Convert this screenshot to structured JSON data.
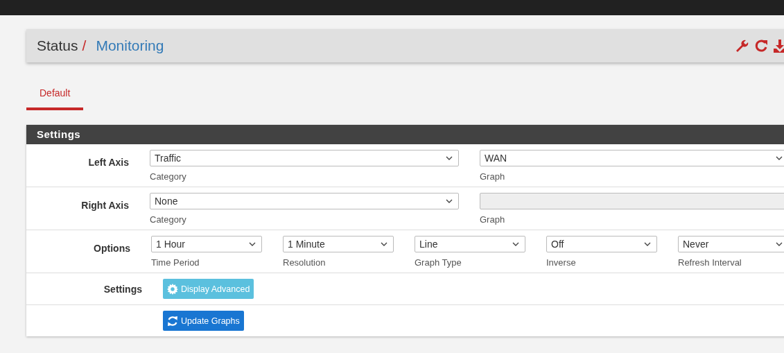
{
  "breadcrumb": {
    "section": "Status",
    "separator": "/",
    "page": "Monitoring"
  },
  "tabs": [
    {
      "label": "Default",
      "selected": true
    }
  ],
  "settings": {
    "title": "Settings",
    "rows": [
      {
        "label": "Left Axis",
        "kind": "axis",
        "fields": [
          {
            "value": "Traffic",
            "caption": "Category",
            "disabled": false
          },
          {
            "value": "WAN",
            "caption": "Graph",
            "disabled": false
          }
        ]
      },
      {
        "label": "Right Axis",
        "kind": "axis",
        "fields": [
          {
            "value": "None",
            "caption": "Category",
            "disabled": false
          },
          {
            "caption": "Graph",
            "disabled": true
          }
        ]
      },
      {
        "label": "Options",
        "kind": "options",
        "fields": [
          {
            "value": "1 Hour",
            "caption": "Time Period",
            "disabled": false
          },
          {
            "value": "1 Minute",
            "caption": "Resolution",
            "disabled": false
          },
          {
            "value": "Line",
            "caption": "Graph Type",
            "disabled": false
          },
          {
            "value": "Off",
            "caption": "Inverse",
            "disabled": false
          },
          {
            "value": "Never",
            "caption": "Refresh Interval",
            "disabled": false
          }
        ]
      },
      {
        "label": "Settings",
        "kind": "advanced",
        "button": "Display Advanced"
      },
      {
        "kind": "update",
        "button": "Update Graphs"
      }
    ]
  }
}
